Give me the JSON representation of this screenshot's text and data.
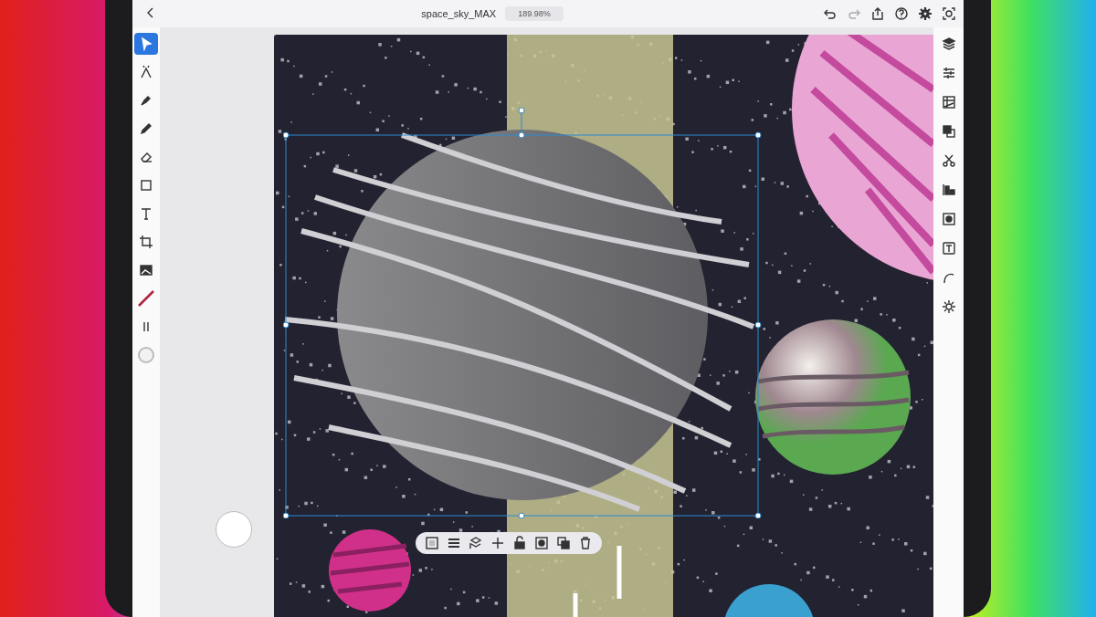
{
  "document": {
    "title": "space_sky_MAX",
    "zoom": "189.98%"
  },
  "tools": [
    {
      "kind": "select",
      "selected": true
    },
    {
      "kind": "direct",
      "selected": false
    },
    {
      "kind": "pen",
      "selected": false
    },
    {
      "kind": "pencil",
      "selected": false
    },
    {
      "kind": "eraser",
      "selected": false
    },
    {
      "kind": "shape",
      "selected": false
    },
    {
      "kind": "type",
      "selected": false
    },
    {
      "kind": "crop",
      "selected": false
    },
    {
      "kind": "image",
      "selected": false
    },
    {
      "kind": "stroke",
      "selected": false
    },
    {
      "kind": "swap",
      "selected": false
    },
    {
      "kind": "fill",
      "selected": false
    }
  ],
  "panels": [
    {
      "kind": "layers"
    },
    {
      "kind": "properties"
    },
    {
      "kind": "grid"
    },
    {
      "kind": "combine"
    },
    {
      "kind": "cut"
    },
    {
      "kind": "align"
    },
    {
      "kind": "mask"
    },
    {
      "kind": "type"
    },
    {
      "kind": "curve"
    },
    {
      "kind": "effects"
    }
  ],
  "context_bar": [
    {
      "kind": "transparency"
    },
    {
      "kind": "menu"
    },
    {
      "kind": "arrange"
    },
    {
      "kind": "add"
    },
    {
      "kind": "lock"
    },
    {
      "kind": "mask"
    },
    {
      "kind": "duplicate"
    },
    {
      "kind": "delete"
    }
  ]
}
